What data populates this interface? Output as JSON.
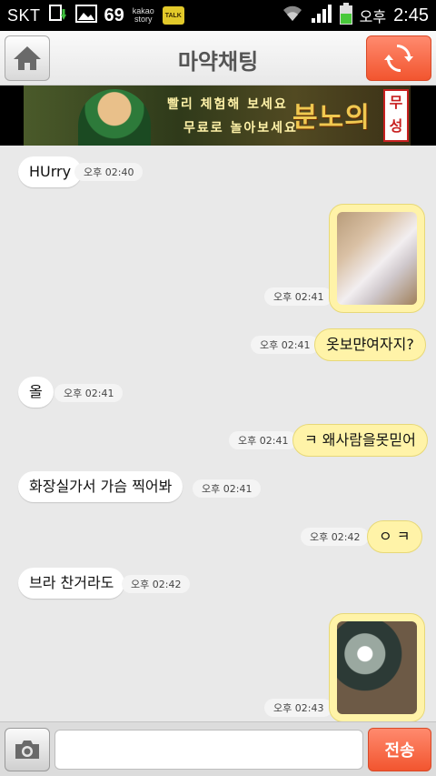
{
  "status_bar": {
    "carrier": "SKT",
    "notification_count": "69",
    "kakaostory_label": "kakao story",
    "kakaotalk_label": "TALK",
    "ampm": "오후",
    "time": "2:45"
  },
  "header": {
    "title": "마약채팅"
  },
  "banner": {
    "line1": "빨리 체험해 보세요",
    "line2": "무료로 놀아보세요",
    "logo": "분노의",
    "seal_top": "무",
    "seal_bottom": "성"
  },
  "messages": [
    {
      "direction": "in",
      "text": "HUrry",
      "time": "오후 02:40"
    },
    {
      "direction": "out",
      "type": "photo",
      "time": "오후 02:41"
    },
    {
      "direction": "out",
      "text": "옷보먄여자지?",
      "time": "오후 02:41"
    },
    {
      "direction": "in",
      "text": "올",
      "time": "오후 02:41"
    },
    {
      "direction": "out",
      "text": "ㅋ 왜사람을못믿어",
      "time": "오후 02:41"
    },
    {
      "direction": "in",
      "text": "화장실가서 가슴 찍어봐",
      "time": "오후 02:41"
    },
    {
      "direction": "out",
      "text": "ㅇ ㅋ",
      "time": "오후 02:42"
    },
    {
      "direction": "in",
      "text": "브라 찬거라도",
      "time": "오후 02:42"
    },
    {
      "direction": "out",
      "type": "photo",
      "time": "오후 02:43"
    }
  ],
  "composer": {
    "input_value": "",
    "send_label": "전송"
  },
  "colors": {
    "accent": "#f2552f",
    "outgoing_bubble": "#fff3a8",
    "incoming_bubble": "#ffffff",
    "chat_background": "#e9e9e9"
  }
}
